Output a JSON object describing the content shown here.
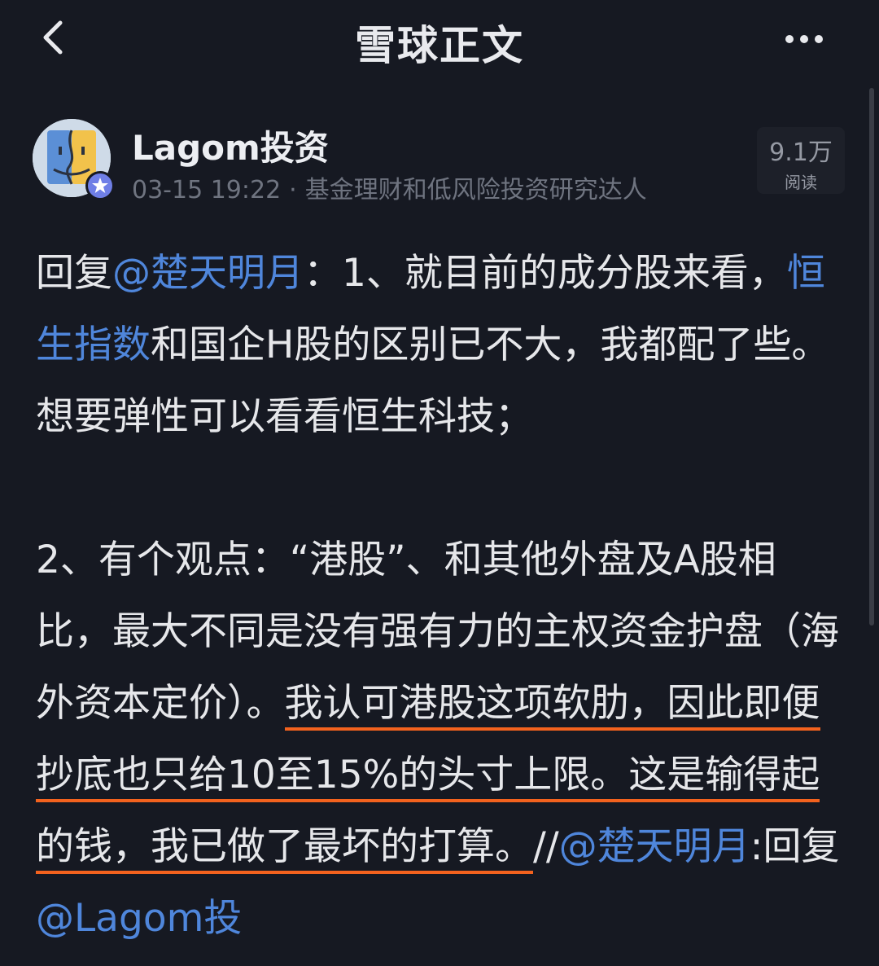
{
  "header": {
    "title": "雪球正文"
  },
  "author": {
    "name": "Lagom投资",
    "time": "03-15 19:22",
    "separator": "·",
    "tagline": "基金理财和低风险投资研究达人",
    "reads_count": "9.1万",
    "reads_label": "阅读"
  },
  "post": {
    "p1": {
      "reply_prefix": "回复",
      "mention": "@楚天明月",
      "text_a": "：1、就目前的成分股来看，",
      "topic": "恒生指数",
      "text_b": "和国企H股的区别已不大，我都配了些。想要弹性可以看看恒生科技；"
    },
    "p2": {
      "text_a": "2、有个观点：“港股”、和其他外盘及A股相比，最大不同是没有强有力的主权资金护盘（海外资本定价）。",
      "highlight": "我认可港股这项软肋，因此即便抄底也只给10至15%的头寸上限。这是输得起的钱，我已做了最坏的打算。",
      "repost_sep": "//",
      "mention2": "@楚天明月",
      "text_b": ":回复",
      "mention3": "@Lagom投"
    }
  },
  "colors": {
    "background": "#161922",
    "link": "#4f86db",
    "underline": "#f3621e",
    "muted": "#6f7480"
  },
  "icons": {
    "back": "chevron-left-icon",
    "more": "more-horizontal-icon",
    "verified": "star-badge-icon"
  }
}
